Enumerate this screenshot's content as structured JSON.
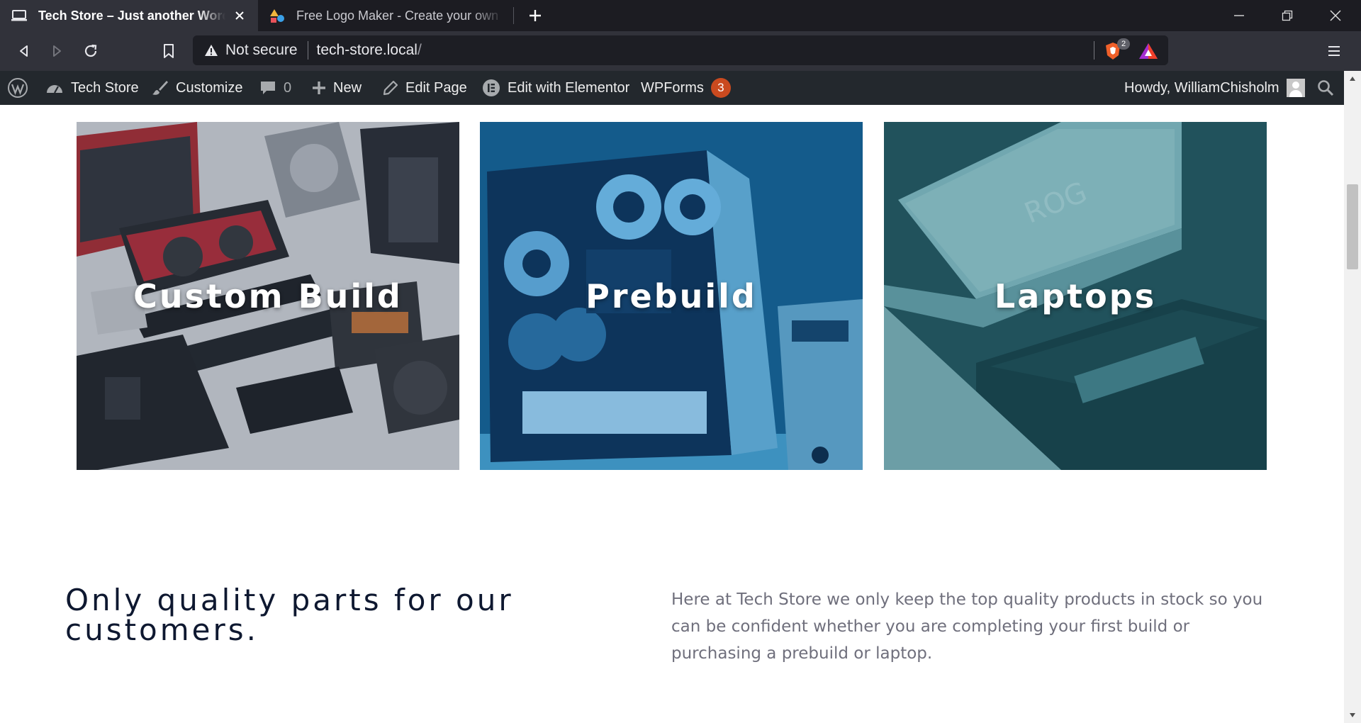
{
  "browser": {
    "tabs": [
      {
        "title": "Tech Store – Just another WordPress site",
        "active": true,
        "favicon": "laptop-favicon-icon"
      },
      {
        "title": "Free Logo Maker - Create your own logo",
        "active": false,
        "favicon": "shapes-favicon-icon"
      }
    ],
    "omnibox": {
      "security_label": "Not secure",
      "host": "tech-store.local",
      "path": "/"
    },
    "shields_count": "2",
    "colors": {
      "tabstrip": "#1c1c22",
      "toolbar": "#31323a",
      "omnibox": "#1d1e24"
    }
  },
  "adminbar": {
    "site_name": "Tech Store",
    "customize": "Customize",
    "comments_count": "0",
    "new": "New",
    "edit_page": "Edit Page",
    "elementor": "Edit with Elementor",
    "wpforms": "WPForms",
    "wpforms_count": "3",
    "howdy": "Howdy, WilliamChisholm",
    "colors": {
      "bar": "#23282d",
      "badge": "#ca4a1f"
    }
  },
  "categories": [
    {
      "label": "Custom Build"
    },
    {
      "label": "Prebuild"
    },
    {
      "label": "Laptops"
    }
  ],
  "intro": {
    "headline_line1": "Only quality parts for our",
    "headline_line2": "customers.",
    "body": "Here at Tech Store we only keep the top quality products in stock so you can be confident whether you are completing your first build or purchasing a prebuild or laptop."
  }
}
